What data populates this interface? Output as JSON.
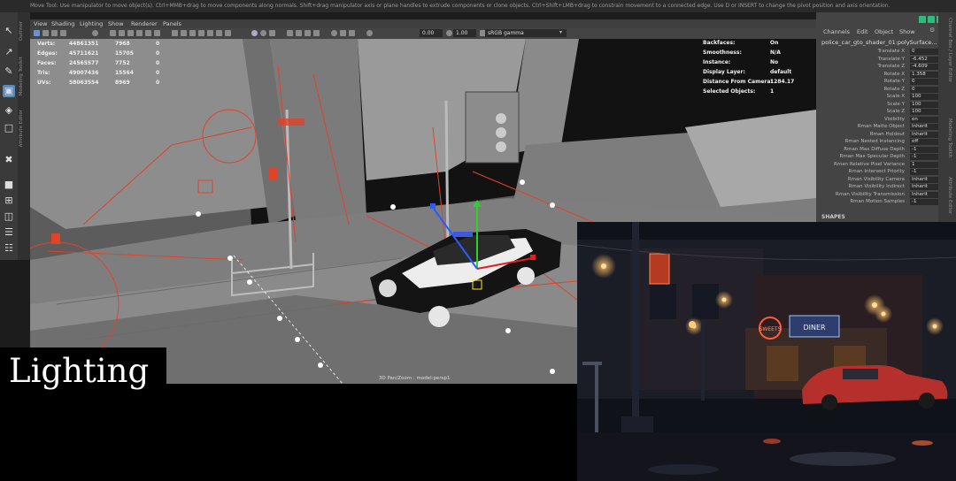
{
  "help_line": "Move Tool: Use manipulator to move object(s). Ctrl+MMB+drag to move components along normals. Shift+drag manipulator axis or plane handles to extrude components or clone objects. Ctrl+Shift+LMB+drag to constrain movement to a connected edge. Use D or INSERT to change the pivot position and axis orientation.",
  "side_tabs": [
    "Outliner",
    "Modeling Toolkit",
    "Attribute Editor"
  ],
  "viewport": {
    "menus": [
      "View",
      "Shading",
      "Lighting",
      "Show",
      "Renderer",
      "Panels"
    ],
    "exposure": "0.00",
    "gamma": "1.00",
    "colorspace": "sRGB gamma",
    "camera_label": "3D Pan/Zoom : model:persp1"
  },
  "hud_stats": [
    {
      "label": "Verts:",
      "total": "44861351",
      "sel": "7968",
      "comp": "0"
    },
    {
      "label": "Edges:",
      "total": "45711621",
      "sel": "15705",
      "comp": "0"
    },
    {
      "label": "Faces:",
      "total": "24565577",
      "sel": "7752",
      "comp": "0"
    },
    {
      "label": "Tris:",
      "total": "49007436",
      "sel": "15564",
      "comp": "0"
    },
    {
      "label": "UVs:",
      "total": "58063554",
      "sel": "8969",
      "comp": "0"
    }
  ],
  "hud_right": [
    {
      "label": "Backfaces:",
      "value": "On"
    },
    {
      "label": "Smoothness:",
      "value": "N/A"
    },
    {
      "label": "Instance:",
      "value": "No"
    },
    {
      "label": "Display Layer:",
      "value": "default"
    },
    {
      "label": "Distance From Camera:",
      "value": "1284.17"
    },
    {
      "label": "Selected Objects:",
      "value": "1"
    }
  ],
  "channel_box": {
    "tabs": [
      "Channels",
      "Edit",
      "Object",
      "Show"
    ],
    "object_name": "police_car_gto_shader_01:polySurface...",
    "attributes": [
      {
        "label": "Translate X",
        "value": "0"
      },
      {
        "label": "Translate Y",
        "value": "-6.452"
      },
      {
        "label": "Translate Z",
        "value": "-4.609"
      },
      {
        "label": "Rotate X",
        "value": "1.358"
      },
      {
        "label": "Rotate Y",
        "value": "0"
      },
      {
        "label": "Rotate Z",
        "value": "0"
      },
      {
        "label": "Scale X",
        "value": "100"
      },
      {
        "label": "Scale Y",
        "value": "100"
      },
      {
        "label": "Scale Z",
        "value": "100"
      },
      {
        "label": "Visibility",
        "value": "on"
      },
      {
        "label": "Rman Matte Object",
        "value": "Inherit"
      },
      {
        "label": "Rman Holdout",
        "value": "Inherit"
      },
      {
        "label": "Rman Nested Instancing",
        "value": "off"
      },
      {
        "label": "Rman Max Diffuse Depth",
        "value": "-1"
      },
      {
        "label": "Rman Max Specular Depth",
        "value": "-1"
      },
      {
        "label": "Rman Relative Pixel Variance",
        "value": "1"
      },
      {
        "label": "Rman Intersect Priority",
        "value": "-1"
      },
      {
        "label": "Rman Visibility Camera",
        "value": "Inherit"
      },
      {
        "label": "Rman Visibility Indirect",
        "value": "Inherit"
      },
      {
        "label": "Rman Visibility Transmission",
        "value": "Inherit"
      },
      {
        "label": "Rman Motion Samples",
        "value": "-1"
      }
    ],
    "shapes_heading": "SHAPES"
  },
  "right_tabs": [
    "Channel Box / Layer Editor",
    "Modeling Toolkit",
    "Attribute Editor"
  ],
  "overlay_title": "Lighting",
  "render_preview": {
    "sign_text": "DINER",
    "neon_text": "SWEETS"
  },
  "colors": {
    "viewport_bg": "#5a5a5a",
    "panel_bg": "#444444",
    "selection_blue": "#5a86b8",
    "light_red": "#e0432a",
    "neon_orange": "#ff7a2f"
  }
}
